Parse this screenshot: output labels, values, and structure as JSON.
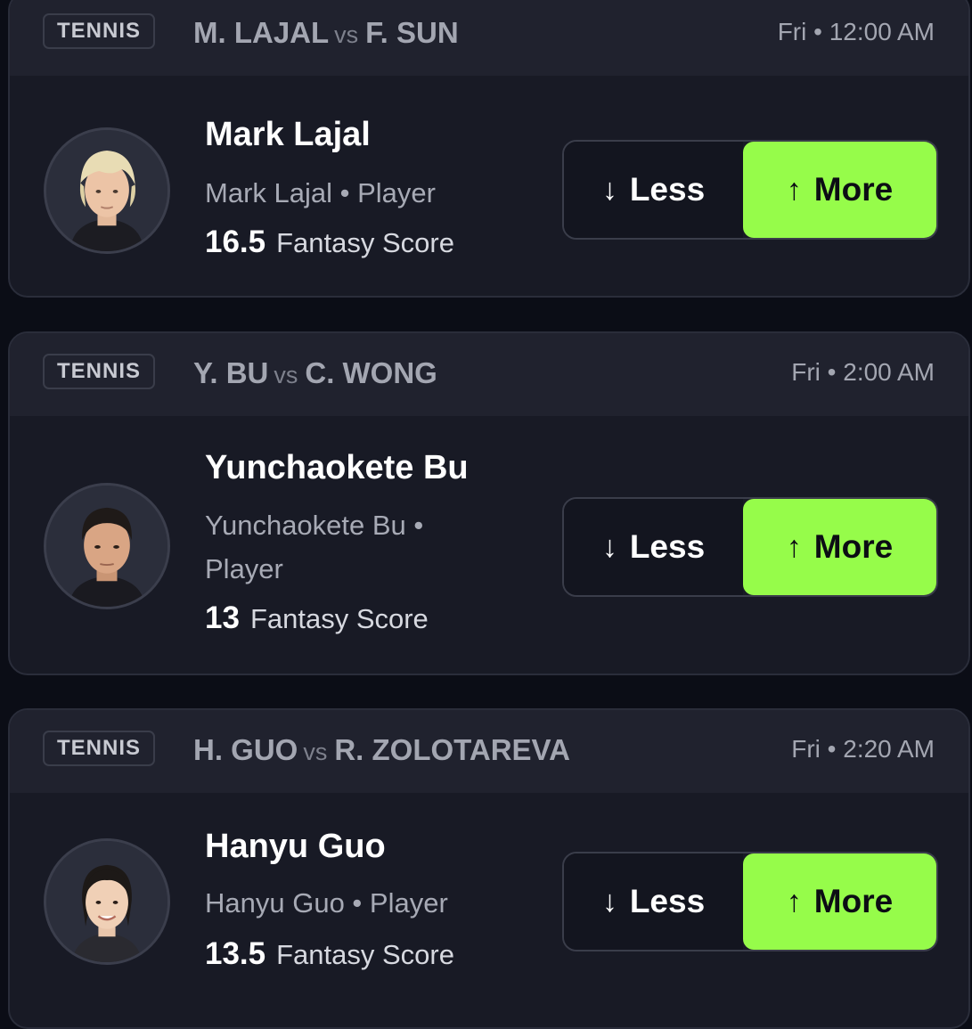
{
  "cards": [
    {
      "sport": "TENNIS",
      "team_a": "M. LAJAL",
      "vs": "vs",
      "team_b": "F. SUN",
      "time": "Fri • 12:00 AM",
      "player_name": "Mark Lajal",
      "player_sub": "Mark Lajal • Player",
      "line_value": "16.5",
      "stat": "Fantasy Score",
      "less_label": "Less",
      "more_label": "More",
      "avatar_icon": "player-photo-blond"
    },
    {
      "sport": "TENNIS",
      "team_a": "Y. BU",
      "vs": "vs",
      "team_b": "C. WONG",
      "time": "Fri • 2:00 AM",
      "player_name": "Yunchaokete Bu",
      "player_sub": "Yunchaokete Bu • Player",
      "line_value": "13",
      "stat": "Fantasy Score",
      "less_label": "Less",
      "more_label": "More",
      "avatar_icon": "player-photo-dark-hair"
    },
    {
      "sport": "TENNIS",
      "team_a": "H. GUO",
      "vs": "vs",
      "team_b": "R. ZOLOTAREVA",
      "time": "Fri • 2:20 AM",
      "player_name": "Hanyu Guo",
      "player_sub": "Hanyu Guo • Player",
      "line_value": "13.5",
      "stat": "Fantasy Score",
      "less_label": "Less",
      "more_label": "More",
      "avatar_icon": "player-photo-pulled-back-hair"
    }
  ],
  "icons": {
    "less": "arrow-down-icon",
    "more": "arrow-up-icon"
  },
  "colors": {
    "background": "#0b0d16",
    "card": "#181a25",
    "header": "#20222e",
    "more_accent": "#96fc4a"
  }
}
